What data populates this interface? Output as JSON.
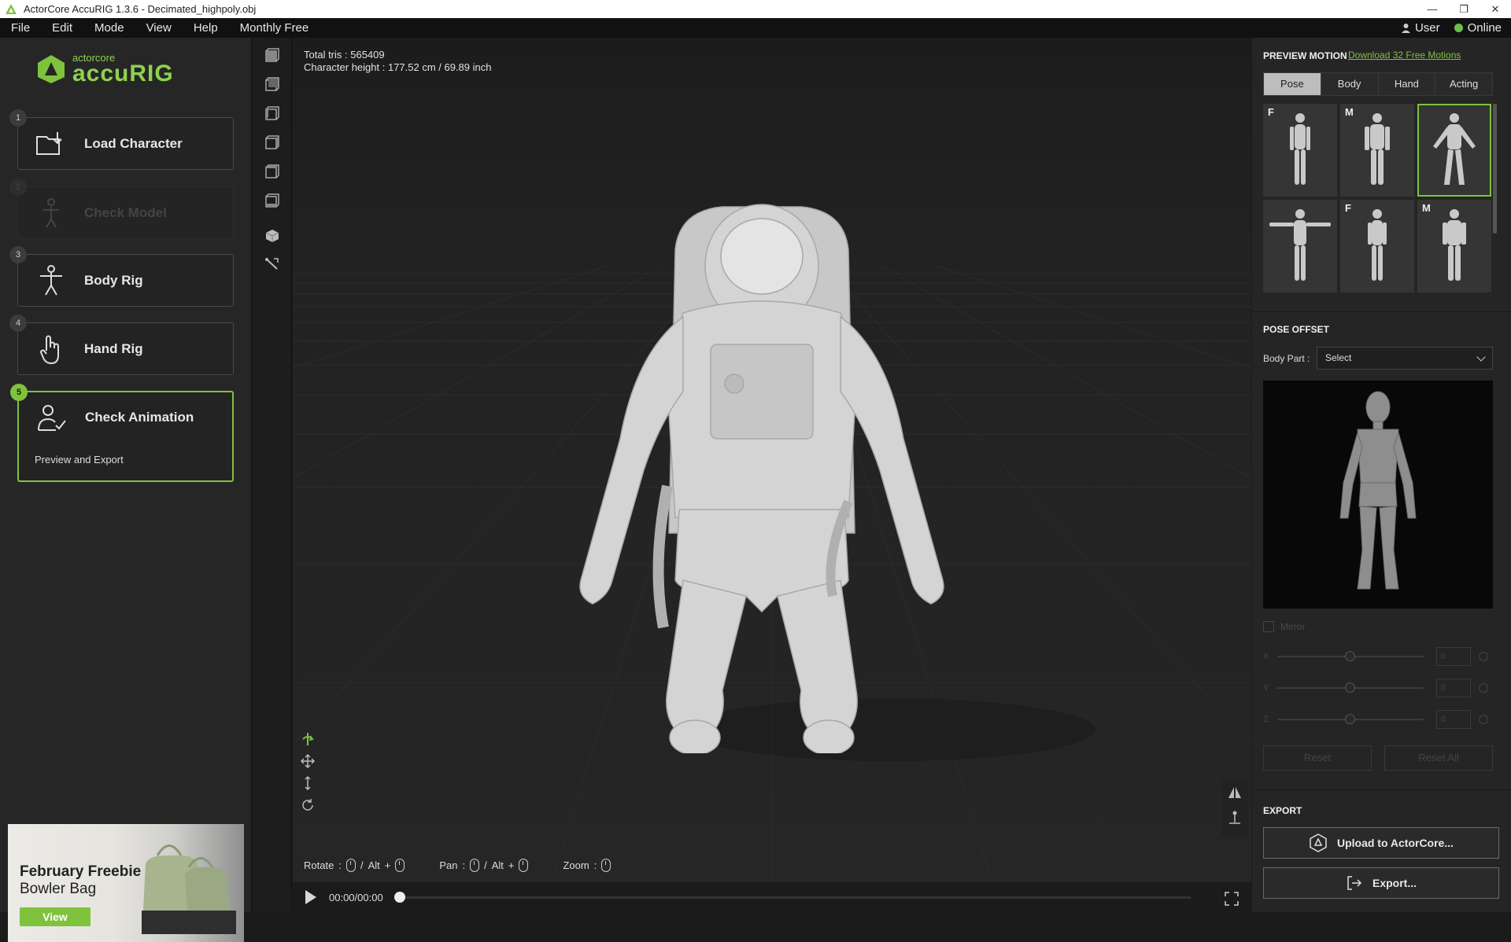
{
  "window": {
    "title": "ActorCore AccuRIG 1.3.6 - Decimated_highpoly.obj",
    "minimize": "—",
    "restore": "❐",
    "close": "✕"
  },
  "menu": {
    "items": [
      "File",
      "Edit",
      "Mode",
      "View",
      "Help",
      "Monthly Free"
    ],
    "user": "User",
    "status": "Online"
  },
  "logo": {
    "small": "actorcore",
    "big": "accuRIG"
  },
  "steps": [
    {
      "num": "1",
      "label": "Load Character",
      "state": "normal"
    },
    {
      "num": "2",
      "label": "Check Model",
      "state": "disabled"
    },
    {
      "num": "3",
      "label": "Body Rig",
      "state": "normal"
    },
    {
      "num": "4",
      "label": "Hand Rig",
      "state": "normal"
    },
    {
      "num": "5",
      "label": "Check Animation",
      "sub": "Preview and Export",
      "state": "active"
    }
  ],
  "promo": {
    "line1": "February Freebie",
    "line2": "Bowler Bag",
    "button": "View"
  },
  "viewport": {
    "tris": "Total tris : 565409",
    "height": "Character height : 177.52 cm / 69.89 inch",
    "hints": {
      "rotate": "Rotate",
      "pan": "Pan",
      "zoom": "Zoom",
      "alt": "Alt",
      "colon": ":",
      "slash": "/",
      "plus": "+"
    },
    "time": "00:00/00:00",
    "progress": 0
  },
  "right": {
    "preview_motion": "PREVIEW MOTION",
    "download_link": "Download 32 Free Motions",
    "tabs": [
      "Pose",
      "Body",
      "Hand",
      "Acting"
    ],
    "selected_tab": "Pose",
    "thumbs": [
      {
        "tag": "F"
      },
      {
        "tag": "M"
      },
      {
        "tag": "",
        "selected": true
      },
      {
        "tag": ""
      },
      {
        "tag": "F"
      },
      {
        "tag": "M"
      }
    ],
    "pose_offset": "POSE OFFSET",
    "body_part_label": "Body Part :",
    "body_part_value": "Select",
    "mirror": "Mirror",
    "axes": [
      {
        "label": "X",
        "value": "0"
      },
      {
        "label": "Y",
        "value": "0"
      },
      {
        "label": "Z",
        "value": "0"
      }
    ],
    "reset": "Reset",
    "reset_all": "Reset All",
    "export_header": "EXPORT",
    "upload": "Upload to ActorCore...",
    "export": "Export..."
  },
  "colors": {
    "accent": "#7fc33d",
    "panel": "#262626",
    "viewport": "#1c1c1c"
  }
}
